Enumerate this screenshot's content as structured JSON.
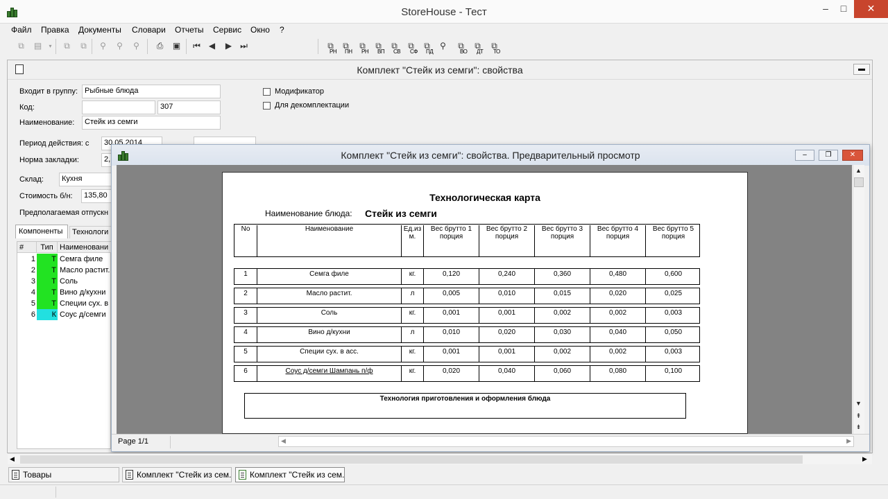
{
  "app": {
    "title": "StoreHouse - Тест",
    "window_buttons": {
      "minimize": "–",
      "maximize": "□",
      "close": "✕"
    }
  },
  "menu": [
    "Файл",
    "Правка",
    "Документы",
    "Словари",
    "Отчеты",
    "Сервис",
    "Окно",
    "?"
  ],
  "toolbar_labels": [
    "РН",
    "ПН",
    "РН",
    "ВП",
    "СВ",
    "СФ",
    "ПД",
    "ВО",
    "ДТ",
    "ТО"
  ],
  "props": {
    "title": "Комплект \"Стейк из семги\": свойства",
    "group_label": "Входит в группу:",
    "group_value": "Рыбные блюда",
    "code_label": "Код:",
    "code_value": "307",
    "name_label": "Наименование:",
    "name_value": "Стейк из семги",
    "modifier_label": "Модификатор",
    "decomp_label": "Для декомплектации",
    "period_label": "Период действия: с",
    "period_value": "30.05.2014",
    "norm_label": "Норма закладки:",
    "norm_value": "2,",
    "store_label": "Склад:",
    "store_value": "Кухня",
    "cost_label": "Стоимость б/н:",
    "cost_value": "135,80",
    "price_label": "Предполагаемая отпускн",
    "tab_components": "Компоненты",
    "tab_tech": "Технологи",
    "grid_headers": [
      "#",
      "Тип",
      "Наименовани"
    ],
    "grid_rows": [
      {
        "n": "1",
        "type": "Т",
        "name": "Семга филе",
        "color": "#22e322"
      },
      {
        "n": "2",
        "type": "Т",
        "name": "Масло растит.",
        "color": "#22e322"
      },
      {
        "n": "3",
        "type": "Т",
        "name": "Соль",
        "color": "#22e322"
      },
      {
        "n": "4",
        "type": "Т",
        "name": "Вино д/кухни",
        "color": "#22e322"
      },
      {
        "n": "5",
        "type": "Т",
        "name": "Специи сух. в",
        "color": "#22e322"
      },
      {
        "n": "6",
        "type": "К",
        "name": "Соус д/семги",
        "color": "#22e0e0"
      }
    ]
  },
  "preview": {
    "title": "Комплект \"Стейк из семги\": свойства. Предварительный просмотр",
    "page_status": "Page 1/1",
    "card_title": "Технологическая карта",
    "dish_label": "Наименование блюда:",
    "dish_name": "Стейк из семги",
    "table_headers": [
      "No",
      "Наименование",
      "Ед.из м.",
      "Вес брутто 1 порция",
      "Вес брутто 2 порция",
      "Вес брутто 3 порция",
      "Вес брутто 4 порция",
      "Вес брутто 5 порция"
    ],
    "rows": [
      {
        "no": "1",
        "name": "Семга филе",
        "unit": "кг.",
        "w": [
          "0,120",
          "0,240",
          "0,360",
          "0,480",
          "0,600"
        ]
      },
      {
        "no": "2",
        "name": "Масло растит.",
        "unit": "л",
        "w": [
          "0,005",
          "0,010",
          "0,015",
          "0,020",
          "0,025"
        ]
      },
      {
        "no": "3",
        "name": "Соль",
        "unit": "кг.",
        "w": [
          "0,001",
          "0,001",
          "0,002",
          "0,002",
          "0,003"
        ]
      },
      {
        "no": "4",
        "name": "Вино д/кухни",
        "unit": "л",
        "w": [
          "0,010",
          "0,020",
          "0,030",
          "0,040",
          "0,050"
        ]
      },
      {
        "no": "5",
        "name": "Специи сух. в асс.",
        "unit": "кг.",
        "w": [
          "0,001",
          "0,001",
          "0,002",
          "0,002",
          "0,003"
        ]
      },
      {
        "no": "6",
        "name": "Соус д/семги Шампань п/ф",
        "unit": "кг.",
        "w": [
          "0,020",
          "0,040",
          "0,060",
          "0,080",
          "0,100"
        ]
      }
    ],
    "tech_section_title": "Технология приготовления и оформления блюда"
  },
  "taskbar": [
    "Товары",
    "Комплект \"Стейк из сем...",
    "Комплект \"Стейк из сем..."
  ]
}
